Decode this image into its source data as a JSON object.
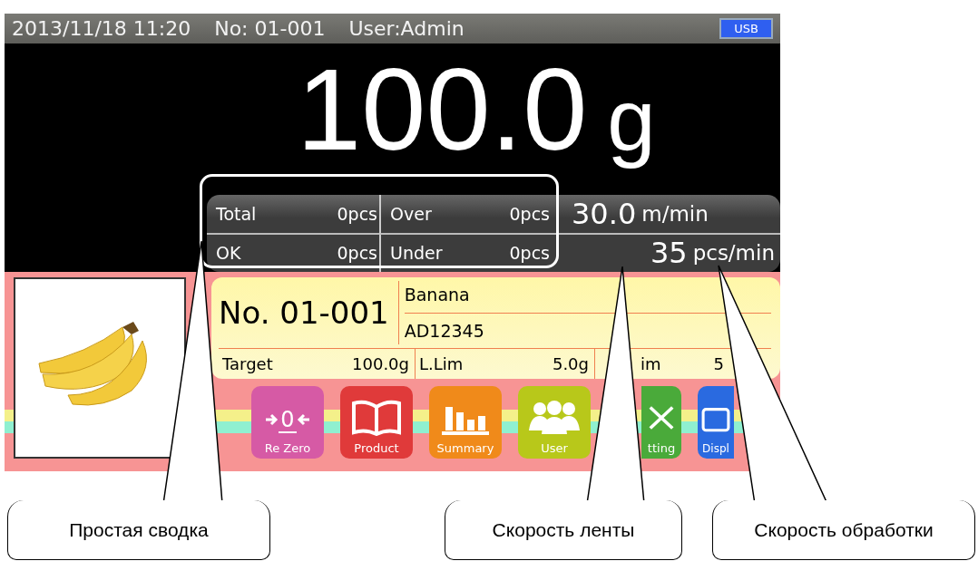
{
  "status_bar": {
    "datetime": "2013/11/18  11:20",
    "number": "No: 01-001",
    "user": "User:Admin",
    "usb_badge": "USB"
  },
  "weight": {
    "value": "100.0",
    "unit": "g"
  },
  "summary": [
    {
      "label": "Total",
      "value": "0pcs"
    },
    {
      "label": "Over",
      "value": "0pcs"
    },
    {
      "label": "OK",
      "value": "0pcs"
    },
    {
      "label": "Under",
      "value": "0pcs"
    }
  ],
  "speed": {
    "belt_value": "30.0",
    "belt_unit": "m/min",
    "rate_value": "35",
    "rate_unit": "pcs/min"
  },
  "product": {
    "number": "No. 01-001",
    "name": "Banana",
    "code": "AD12345",
    "fields": [
      {
        "label": "Target",
        "value": "100.0g"
      },
      {
        "label": "L.Lim",
        "value": "5.0g"
      },
      {
        "label": "im",
        "value": "5"
      }
    ]
  },
  "buttons": [
    {
      "kind": "rezero",
      "label": "Re Zero",
      "color": "#d65aa5",
      "icon_text": "0"
    },
    {
      "kind": "product",
      "label": "Product",
      "color": "#e03a3a"
    },
    {
      "kind": "summary",
      "label": "Summary",
      "color": "#f08a1a"
    },
    {
      "kind": "user",
      "label": "User",
      "color": "#b8c81a"
    },
    {
      "kind": "setting",
      "label": "tting",
      "color": "#4aaa3a"
    },
    {
      "kind": "display",
      "label": "Displ",
      "color": "#2a6ae0"
    }
  ],
  "callouts": [
    {
      "text": "Простая сводка"
    },
    {
      "text": "Скорость ленты"
    },
    {
      "text": "Скорость обработки"
    }
  ]
}
